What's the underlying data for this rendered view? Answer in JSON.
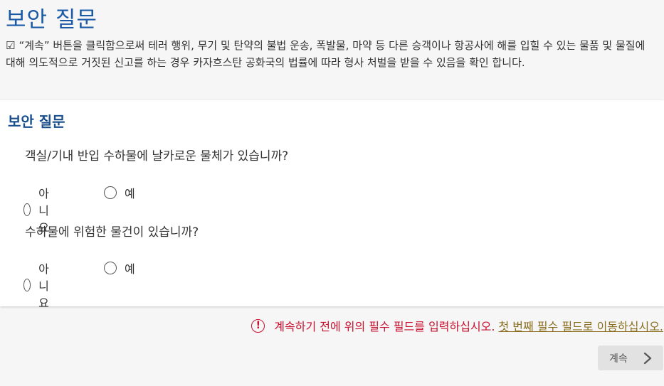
{
  "page": {
    "title": "보안 질문",
    "disclaimer_check": "☑",
    "disclaimer": "“계속” 버튼을 클릭함으로써 테러 행위, 무기 및 탄약의 불법 운송, 폭발물, 마약 등 다른 승객이나 항공사에 해를 입힐 수 있는 물품 및 물질에 대해 의도적으로 거짓된 신고를 하는 경우 카자흐스탄 공화국의 법률에 따라 형사 처벌을 받을 수 있음을 확인 합니다."
  },
  "section": {
    "title": "보안 질문",
    "questions": [
      {
        "text": "객실/기내 반입 수하물에 날카로운 물체가 있습니까?",
        "options": [
          "아니요",
          "예"
        ]
      },
      {
        "text": "수하물에 위험한 물건이 있습니까?",
        "options": [
          "아니요",
          "예"
        ]
      }
    ]
  },
  "error": {
    "icon": "alert-circle-icon",
    "message": "계속하기 전에 위의 필수 필드를 입력하십시오.",
    "link": "첫 번째 필수 필드로 이동하십시오."
  },
  "actions": {
    "continue_label": "계속",
    "continue_icon": "chevron-right-icon"
  },
  "colors": {
    "title": "#1a5aa6",
    "error": "#c8102e",
    "link": "#8a6d1f"
  }
}
